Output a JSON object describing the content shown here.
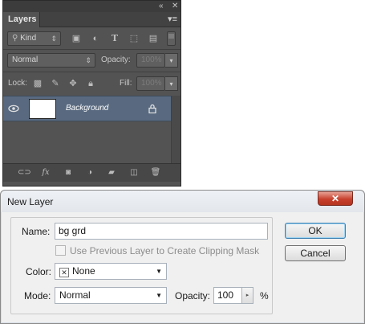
{
  "layers_panel": {
    "tab_label": "Layers",
    "filter": {
      "label": "Kind"
    },
    "blend_mode": "Normal",
    "opacity": {
      "label": "Opacity:",
      "value": "100%"
    },
    "lock_label": "Lock:",
    "fill": {
      "label": "Fill:",
      "value": "100%"
    },
    "layer": {
      "name": "Background"
    },
    "accent": "#596a80"
  },
  "dialog": {
    "title": "New Layer",
    "name_label": "Name:",
    "name_value": "bg grd",
    "clipping_mask_label": "Use Previous Layer to Create Clipping Mask",
    "color_label": "Color:",
    "color_value": "None",
    "mode_label": "Mode:",
    "mode_value": "Normal",
    "opacity_label": "Opacity:",
    "opacity_value": "100",
    "opacity_unit": "%",
    "ok_label": "OK",
    "cancel_label": "Cancel"
  }
}
